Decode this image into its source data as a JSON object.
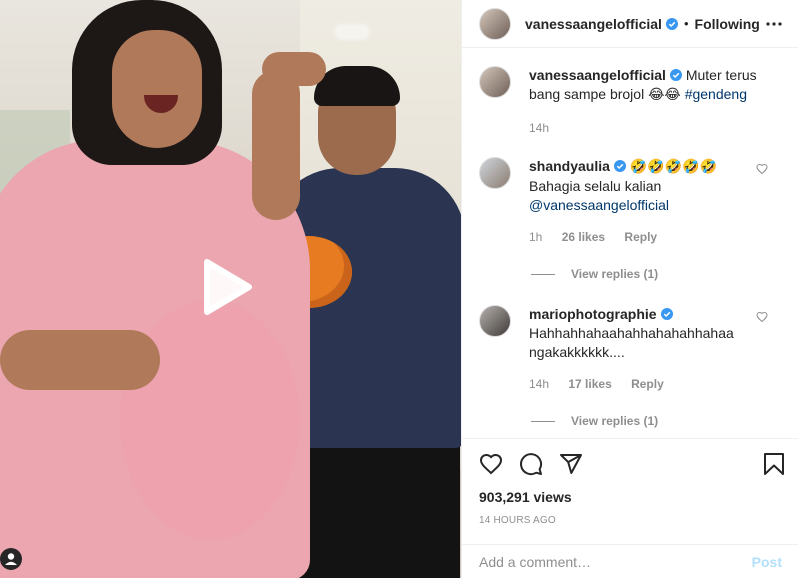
{
  "post": {
    "author": "vanessaangelofficial",
    "separator": "•",
    "follow_status": "Following",
    "caption": {
      "username": "vanessaangelofficial",
      "text": "Muter terus bang sampe brojol 😂😂 ",
      "hashtag": "#gendeng",
      "age": "14h"
    },
    "comments": [
      {
        "username": "shandyaulia",
        "emojis": "🤣🤣🤣🤣🤣",
        "line1": "Bahagia selalu kalian",
        "mention": "@vanessaangelofficial",
        "age": "1h",
        "likes": "26 likes",
        "reply": "Reply",
        "view_replies": "View replies (1)"
      },
      {
        "username": "mariophotographie",
        "line1": "Hahhahhahaahahhahahahhahaa",
        "line2": "ngakakkkkkk....",
        "age": "14h",
        "likes": "17 likes",
        "reply": "Reply",
        "view_replies": "View replies (1)"
      }
    ],
    "views": "903,291 views",
    "timestamp": "14 HOURS AGO",
    "add_comment_placeholder": "Add a comment…",
    "post_label": "Post"
  },
  "icons": {
    "more": "more-horizontal-icon",
    "verified": "verified-badge-icon",
    "like": "heart-icon",
    "comment": "comment-icon",
    "share": "share-icon",
    "save": "bookmark-icon",
    "play": "play-icon",
    "tagged": "user-tag-icon"
  },
  "colors": {
    "verified": "#3897f0",
    "link": "#00376b",
    "muted": "#8e8e8e",
    "post_disabled": "#b2dffc"
  }
}
